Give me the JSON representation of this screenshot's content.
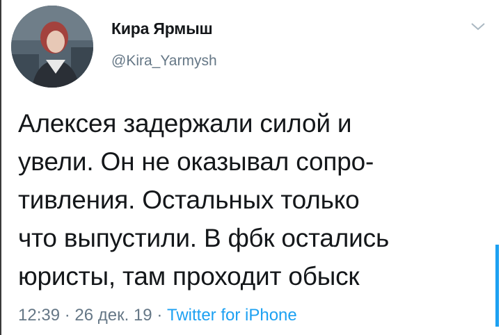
{
  "tweet": {
    "author": {
      "display_name": "Кира Ярмыш",
      "handle": "@Kira_Yarmysh",
      "avatar_icon": "profile-photo"
    },
    "menu_icon": "chevron-down-icon",
    "text": "Алексея задержали силой и\nувели. Он не оказывал сопро-\nтивления. Остальных только\nчто выпустили. В фбк остались\nюристы, там проходит обыск",
    "time": "12:39",
    "separator_1": "·",
    "date": "26 дек. 19",
    "separator_2": "·",
    "source": "Twitter for iPhone"
  },
  "colors": {
    "text": "#14171a",
    "secondary": "#657786",
    "accent": "#1da1f2"
  }
}
